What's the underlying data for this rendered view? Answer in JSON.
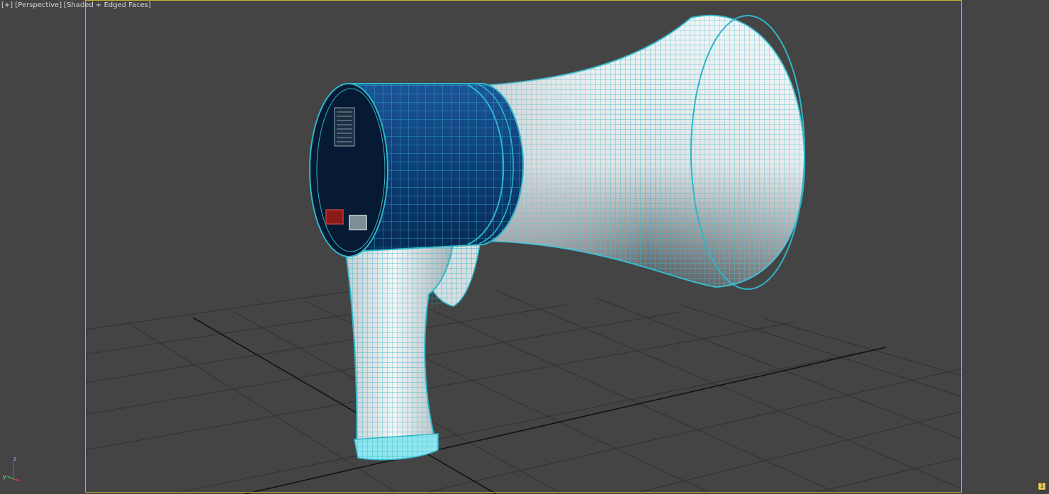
{
  "viewport": {
    "label_parts": [
      "[+]",
      "[Perspective]",
      "[Shaded + Edged Faces]"
    ],
    "background": "#444444",
    "safe_frame_color": "#c9b12a"
  },
  "scene": {
    "object": "megaphone",
    "colors": {
      "wire": "#2fb6c9",
      "body_blue": "#0c3f78",
      "body_dark": "#061a33",
      "horn_light": "#e9eef0",
      "horn_shadow": "#565b5f",
      "grid": "#2c2c2c",
      "grid_axis": "#111111",
      "button_red": "#8a1a1a",
      "button_gray": "#8a9aa0"
    }
  },
  "axis_gizmo": {
    "z_label": "z",
    "y_label": "y",
    "x_label": "x"
  },
  "corner_badge": {
    "text": "1"
  }
}
